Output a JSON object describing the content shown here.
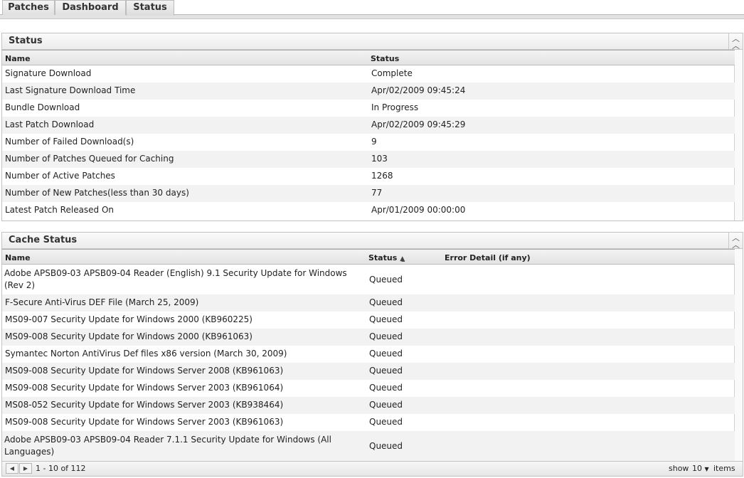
{
  "tabs": [
    {
      "label": "Patches"
    },
    {
      "label": "Dashboard"
    },
    {
      "label": "Status"
    }
  ],
  "status_panel": {
    "title": "Status",
    "columns": [
      "Name",
      "Status"
    ],
    "rows": [
      {
        "name": "Signature Download",
        "status": "Complete"
      },
      {
        "name": "Last Signature Download Time",
        "status": "Apr/02/2009 09:45:24"
      },
      {
        "name": "Bundle Download",
        "status": "In Progress"
      },
      {
        "name": "Last Patch Download",
        "status": "Apr/02/2009 09:45:29"
      },
      {
        "name": "Number of Failed Download(s)",
        "status": "9"
      },
      {
        "name": "Number of Patches Queued for Caching",
        "status": "103"
      },
      {
        "name": "Number of Active Patches",
        "status": "1268"
      },
      {
        "name": "Number of New Patches(less than 30 days)",
        "status": "77"
      },
      {
        "name": "Latest Patch Released On",
        "status": "Apr/01/2009 00:00:00"
      }
    ]
  },
  "cache_panel": {
    "title": "Cache Status",
    "columns": [
      "Name",
      "Status",
      "Error Detail (if any)"
    ],
    "rows": [
      {
        "name": "Adobe APSB09-03 APSB09-04 Reader (English) 9.1 Security Update for Windows (Rev 2)",
        "status": "Queued",
        "error": ""
      },
      {
        "name": "F-Secure Anti-Virus DEF File (March 25, 2009)",
        "status": "Queued",
        "error": ""
      },
      {
        "name": "MS09-007 Security Update for Windows 2000 (KB960225)",
        "status": "Queued",
        "error": ""
      },
      {
        "name": "MS09-008 Security Update for Windows 2000 (KB961063)",
        "status": "Queued",
        "error": ""
      },
      {
        "name": "Symantec Norton AntiVirus Def files x86 version (March 30, 2009)",
        "status": "Queued",
        "error": ""
      },
      {
        "name": "MS09-008 Security Update for Windows Server 2008 (KB961063)",
        "status": "Queued",
        "error": ""
      },
      {
        "name": "MS09-008 Security Update for Windows Server 2003 (KB961064)",
        "status": "Queued",
        "error": ""
      },
      {
        "name": "MS08-052 Security Update for Windows Server 2003 (KB938464)",
        "status": "Queued",
        "error": ""
      },
      {
        "name": "MS09-008 Security Update for Windows Server 2003 (KB961063)",
        "status": "Queued",
        "error": ""
      },
      {
        "name": "Adobe APSB09-03 APSB09-04 Reader 7.1.1 Security Update for Windows (All Languages)",
        "status": "Queued",
        "error": ""
      }
    ],
    "pager": {
      "range": "1 - 10 of 112",
      "show_label": "show",
      "page_size": "10",
      "items_label": "items"
    }
  },
  "icons": {
    "collapse": "double-chevron-up-icon",
    "sort": "sort-ascending-icon",
    "prev": "triangle-left-icon",
    "next": "triangle-right-icon",
    "dropdown": "triangle-down-icon"
  }
}
